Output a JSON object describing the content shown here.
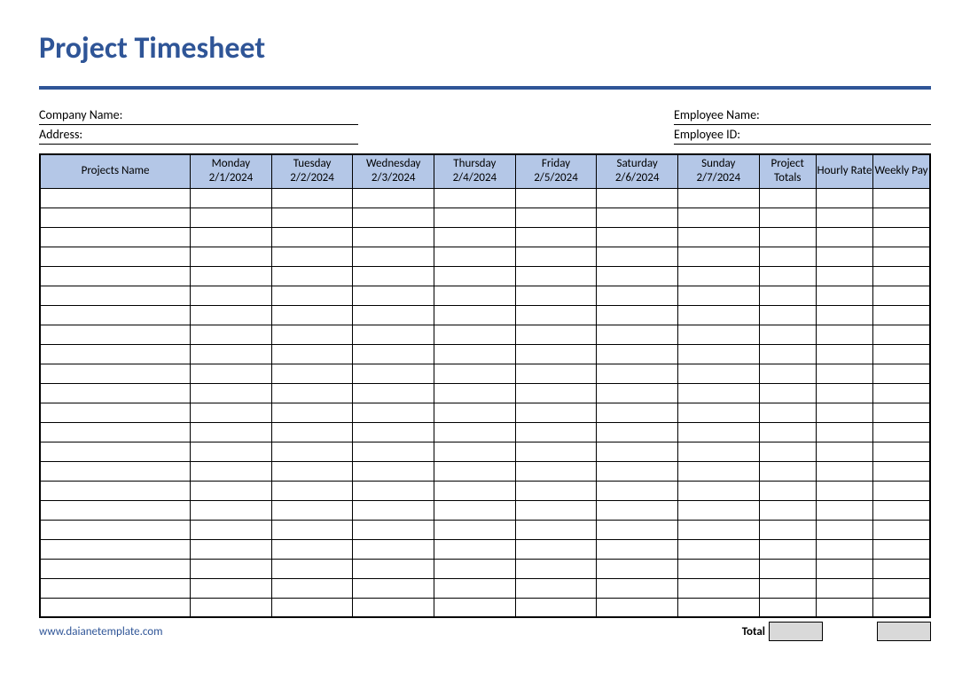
{
  "title": "Project Timesheet",
  "fields": {
    "company_name_label": "Company Name:",
    "address_label": "Address:",
    "employee_name_label": "Employee Name:",
    "employee_id_label": "Employee ID:"
  },
  "columns": {
    "projects": "Projects Name",
    "days": [
      {
        "day": "Monday",
        "date": "2/1/2024"
      },
      {
        "day": "Tuesday",
        "date": "2/2/2024"
      },
      {
        "day": "Wednesday",
        "date": "2/3/2024"
      },
      {
        "day": "Thursday",
        "date": "2/4/2024"
      },
      {
        "day": "Friday",
        "date": "2/5/2024"
      },
      {
        "day": "Saturday",
        "date": "2/6/2024"
      },
      {
        "day": "Sunday",
        "date": "2/7/2024"
      }
    ],
    "project_totals": "Project Totals",
    "hourly_rate": "Hourly Rate",
    "weekly_pay": "Weekly Pay"
  },
  "data_row_count": 22,
  "footer": {
    "link": "www.daianetemplate.com",
    "total_label": "Total"
  }
}
